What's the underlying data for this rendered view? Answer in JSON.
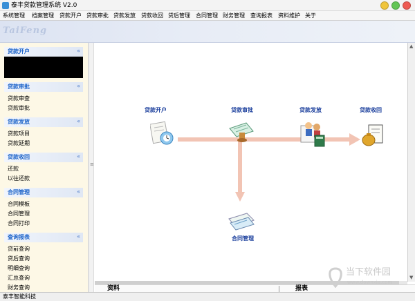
{
  "window": {
    "title": "泰丰贷款管理系统 V2.0",
    "controls": {
      "min_color": "#f0c53c",
      "max_color": "#62c554",
      "close_color": "#ee5a52"
    }
  },
  "menu": [
    "系统管理",
    "档案管理",
    "贷款开户",
    "贷款审批",
    "贷款发放",
    "贷款收回",
    "贷后管理",
    "合同管理",
    "财务管理",
    "查询报表",
    "资料维护",
    "关于"
  ],
  "banner": {
    "logo": "TaiFeng"
  },
  "sidebar": {
    "sections": [
      {
        "title": "贷款开户",
        "items": []
      },
      {
        "title": "贷款审批",
        "items": [
          "贷款审查",
          "贷款审批"
        ]
      },
      {
        "title": "贷款发放",
        "items": [
          "贷款项目",
          "贷款延期"
        ]
      },
      {
        "title": "贷款收回",
        "items": [
          "还款",
          "以往还款"
        ]
      },
      {
        "title": "合同管理",
        "items": [
          "合同模板",
          "合同管理",
          "合同打印"
        ]
      },
      {
        "title": "查询报表",
        "items": [
          "贷前查询",
          "贷后查询",
          "明细查询",
          "汇总查询",
          "财务查询"
        ]
      }
    ],
    "chevron": "«"
  },
  "flow": {
    "nodes": {
      "open": "贷款开户",
      "approve": "贷款审批",
      "issue": "贷款发放",
      "recover": "贷款收回",
      "contract": "合同管理"
    },
    "arrow_color": "#f2c4b4",
    "label_color": "#1a3e9c"
  },
  "bottom": {
    "left_label": "资料",
    "right_label": "报表"
  },
  "status": {
    "company": "泰丰智能科技"
  },
  "watermark": {
    "title": "当下软件园",
    "url": "www.downxia.com"
  },
  "colors": {
    "section_title": "#1a62c9",
    "sidebar_bg": "#fdf8e6",
    "banner_bg": "#dce3f2"
  }
}
